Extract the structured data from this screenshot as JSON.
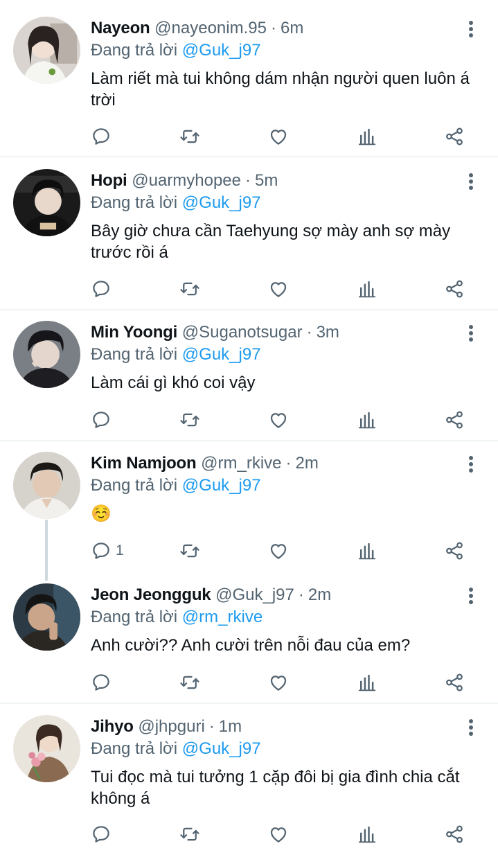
{
  "reply_prefix": "Đang trả lời",
  "separator": "·",
  "colors": {
    "accent": "#1d9bf0",
    "muted": "#536471",
    "divider": "#eff3f4"
  },
  "icons": [
    "reply-icon",
    "retweet-icon",
    "like-icon",
    "views-icon",
    "share-icon",
    "more-icon"
  ],
  "tweets": [
    {
      "name": "Nayeon",
      "handle": "@nayeonim.95",
      "time": "6m",
      "mention": "@Guk_j97",
      "text": "Làm riết mà tui không dám nhận người quen luôn á trời",
      "reply_count": ""
    },
    {
      "name": "Hopi",
      "handle": "@uarmyhopee",
      "time": "5m",
      "mention": "@Guk_j97",
      "text": "Bây giờ chưa cần Taehyung sợ mày anh sợ mày trước rồi á",
      "reply_count": ""
    },
    {
      "name": "Min Yoongi",
      "handle": "@Suganotsugar",
      "time": "3m",
      "mention": "@Guk_j97",
      "text": "Làm cái gì khó coi vậy",
      "reply_count": ""
    },
    {
      "name": "Kim Namjoon",
      "handle": "@rm_rkive",
      "time": "2m",
      "mention": "@Guk_j97",
      "text": "☺️",
      "reply_count": "1"
    },
    {
      "name": "Jeon Jeongguk",
      "handle": "@Guk_j97",
      "time": "2m",
      "mention": "@rm_rkive",
      "text": "Anh cười?? Anh cười trên nỗi đau của em?",
      "reply_count": ""
    },
    {
      "name": "Jihyo",
      "handle": "@jhpguri",
      "time": "1m",
      "mention": "@Guk_j97",
      "text": "Tui đọc mà tui tưởng 1 cặp đôi bị gia đình chia cắt không á",
      "reply_count": ""
    }
  ]
}
